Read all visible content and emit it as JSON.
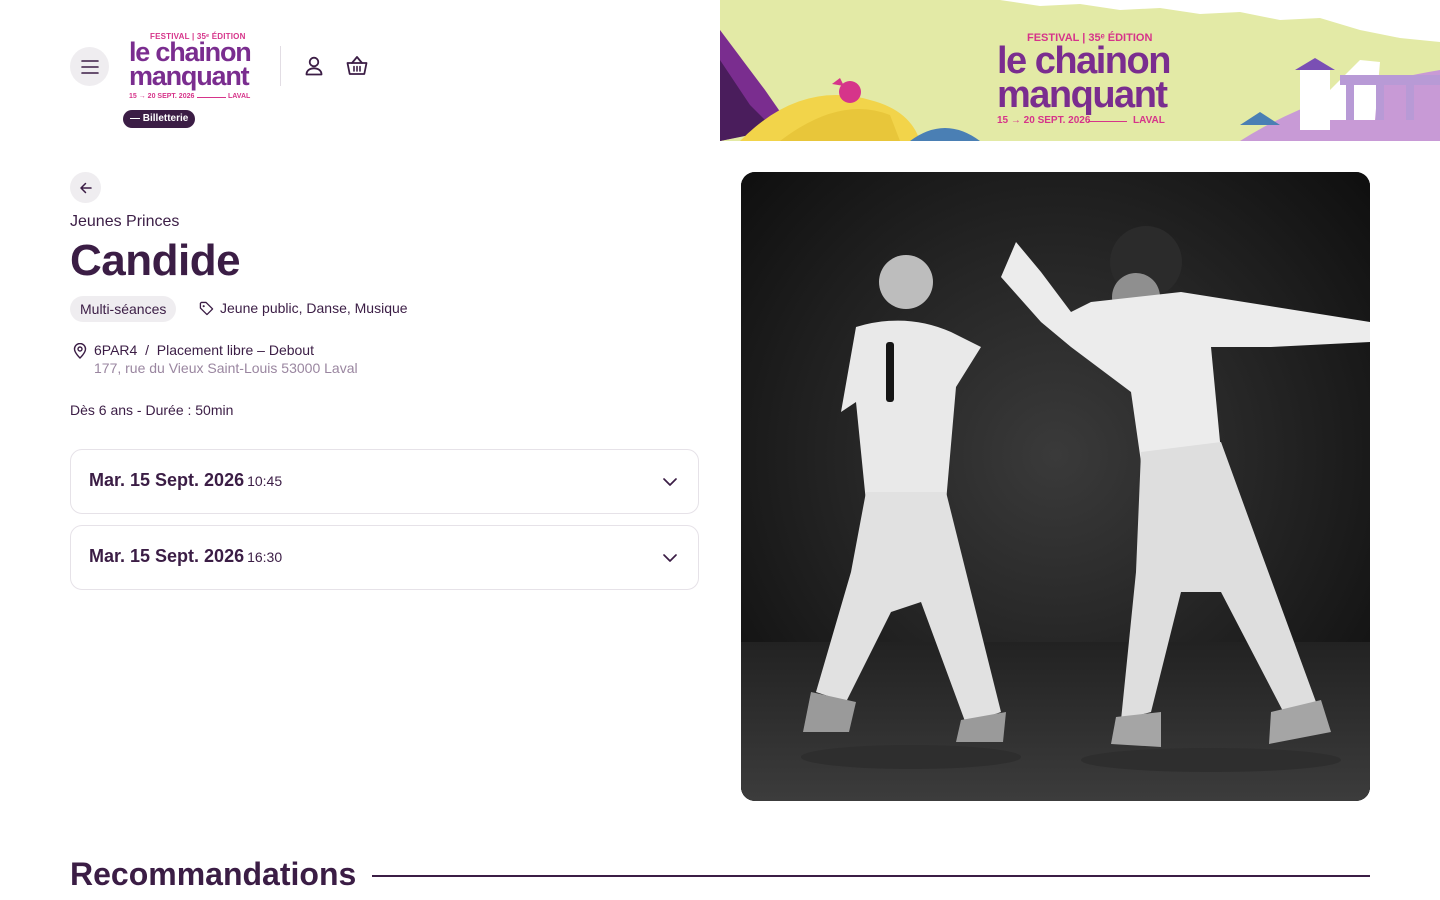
{
  "header": {
    "logo": {
      "festival": "FESTIVAL | 35ᵉ ÉDITION",
      "name_line1": "le chainon",
      "name_line2": "manquant",
      "dates": "15 → 20 SEPT. 2026",
      "city": "LAVAL"
    },
    "billetterie_label": "— Billetterie"
  },
  "banner": {
    "festival": "FESTIVAL | 35ᵉ ÉDITION",
    "name_line1": "le chainon",
    "name_line2": "manquant",
    "dates": "15 → 20 SEPT. 2026",
    "city": "LAVAL",
    "background_color": "#e3eaa6",
    "accent_pink": "#d6348a",
    "accent_purple": "#7a2d8f"
  },
  "event": {
    "company": "Jeunes Princes",
    "title": "Candide",
    "session_type": "Multi-séances",
    "tags": "Jeune public, Danse, Musique",
    "venue_name": "6PAR4",
    "venue_separator": "/",
    "placement": "Placement libre – Debout",
    "address": "177, rue du Vieux Saint-Louis 53000 Laval",
    "info": "Dès 6 ans - Durée : 50min"
  },
  "sessions": [
    {
      "date": "Mar. 15 Sept. 2026",
      "time": "10:45"
    },
    {
      "date": "Mar. 15 Sept. 2026",
      "time": "16:30"
    }
  ],
  "recommandations": {
    "title": "Recommandations"
  },
  "colors": {
    "primary": "#3b1d45",
    "muted": "#9a86a0",
    "pill_bg": "#efedf0"
  }
}
